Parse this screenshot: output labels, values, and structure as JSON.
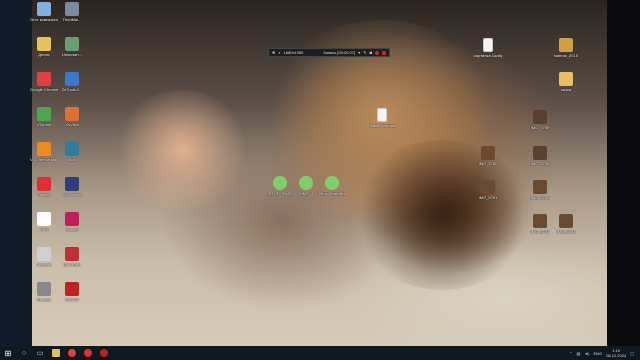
{
  "desktop_icons_left": [
    {
      "label": "Этот компьютер",
      "color": "#7fb0e0"
    },
    {
      "label": "ThirdMai...",
      "color": "#7a8aa0"
    },
    {
      "label": "Денис",
      "color": "#e8c060"
    },
    {
      "label": "Unknown...",
      "color": "#6aa070"
    },
    {
      "label": "Google Chrome",
      "color": "#e04040"
    },
    {
      "label": "ZeTools 2...",
      "color": "#3a78d0"
    },
    {
      "label": "uTorrent",
      "color": "#4ca64c"
    },
    {
      "label": "XnView",
      "color": "#e07030"
    },
    {
      "label": "VLC media player",
      "color": "#f08a20"
    },
    {
      "label": "Nox",
      "color": "#2a7f9e"
    },
    {
      "label": "Yandex",
      "color": "#e03030"
    },
    {
      "label": "Nox Assist",
      "color": "#2a3f7e"
    },
    {
      "label": "VPN",
      "color": "#ffffff"
    },
    {
      "label": "ShareX",
      "color": "#c02060"
    },
    {
      "label": "Anydesk",
      "color": "#d0d0d0"
    },
    {
      "label": "Bandicam",
      "color": "#c03030"
    },
    {
      "label": "Recycle",
      "color": "#888888"
    },
    {
      "label": "AIDA64",
      "color": "#c02020"
    }
  ],
  "recorder": {
    "resolution": "1680x1050",
    "status": "Запись [00:00:27]"
  },
  "mid_icons": [
    {
      "label": "SETUP_SIMS3",
      "color": "#7ecf6a"
    },
    {
      "label": "SIMS_4",
      "color": "#7ecf6a"
    },
    {
      "label": "Sims4 Installer",
      "color": "#7ecf6a"
    }
  ],
  "file_icons": [
    {
      "label": "Новый текстовый...",
      "color": "#f4f4f4"
    },
    {
      "label": "картинка Скайрим",
      "color": "#f4f4f4"
    }
  ],
  "right_icons": [
    {
      "label": "мангас_2015",
      "color": "#d0a040"
    },
    {
      "label": "качка",
      "color": "#e8c060"
    },
    {
      "label": "IMG_5759",
      "color": "#5a4030"
    },
    {
      "label": "IMG_5756",
      "color": "#5a4030"
    },
    {
      "label": "IMG_5760",
      "color": "#6a4a30"
    },
    {
      "label": "IMG_5761",
      "color": "#6a4a30"
    },
    {
      "label": "IMG_5763",
      "color": "#6a4a30"
    },
    {
      "label": "IMG_5762",
      "color": "#6a4a30"
    },
    {
      "label": "IMG_5808",
      "color": "#6a4a30"
    }
  ],
  "taskbar": {
    "apps": [
      "start-icon",
      "search-icon",
      "task-view-icon",
      "explorer-icon",
      "chrome-icon",
      "yandex-icon",
      "recorder-icon"
    ],
    "lang": "ENG",
    "time": "1:10",
    "date": "08.12.2024"
  }
}
